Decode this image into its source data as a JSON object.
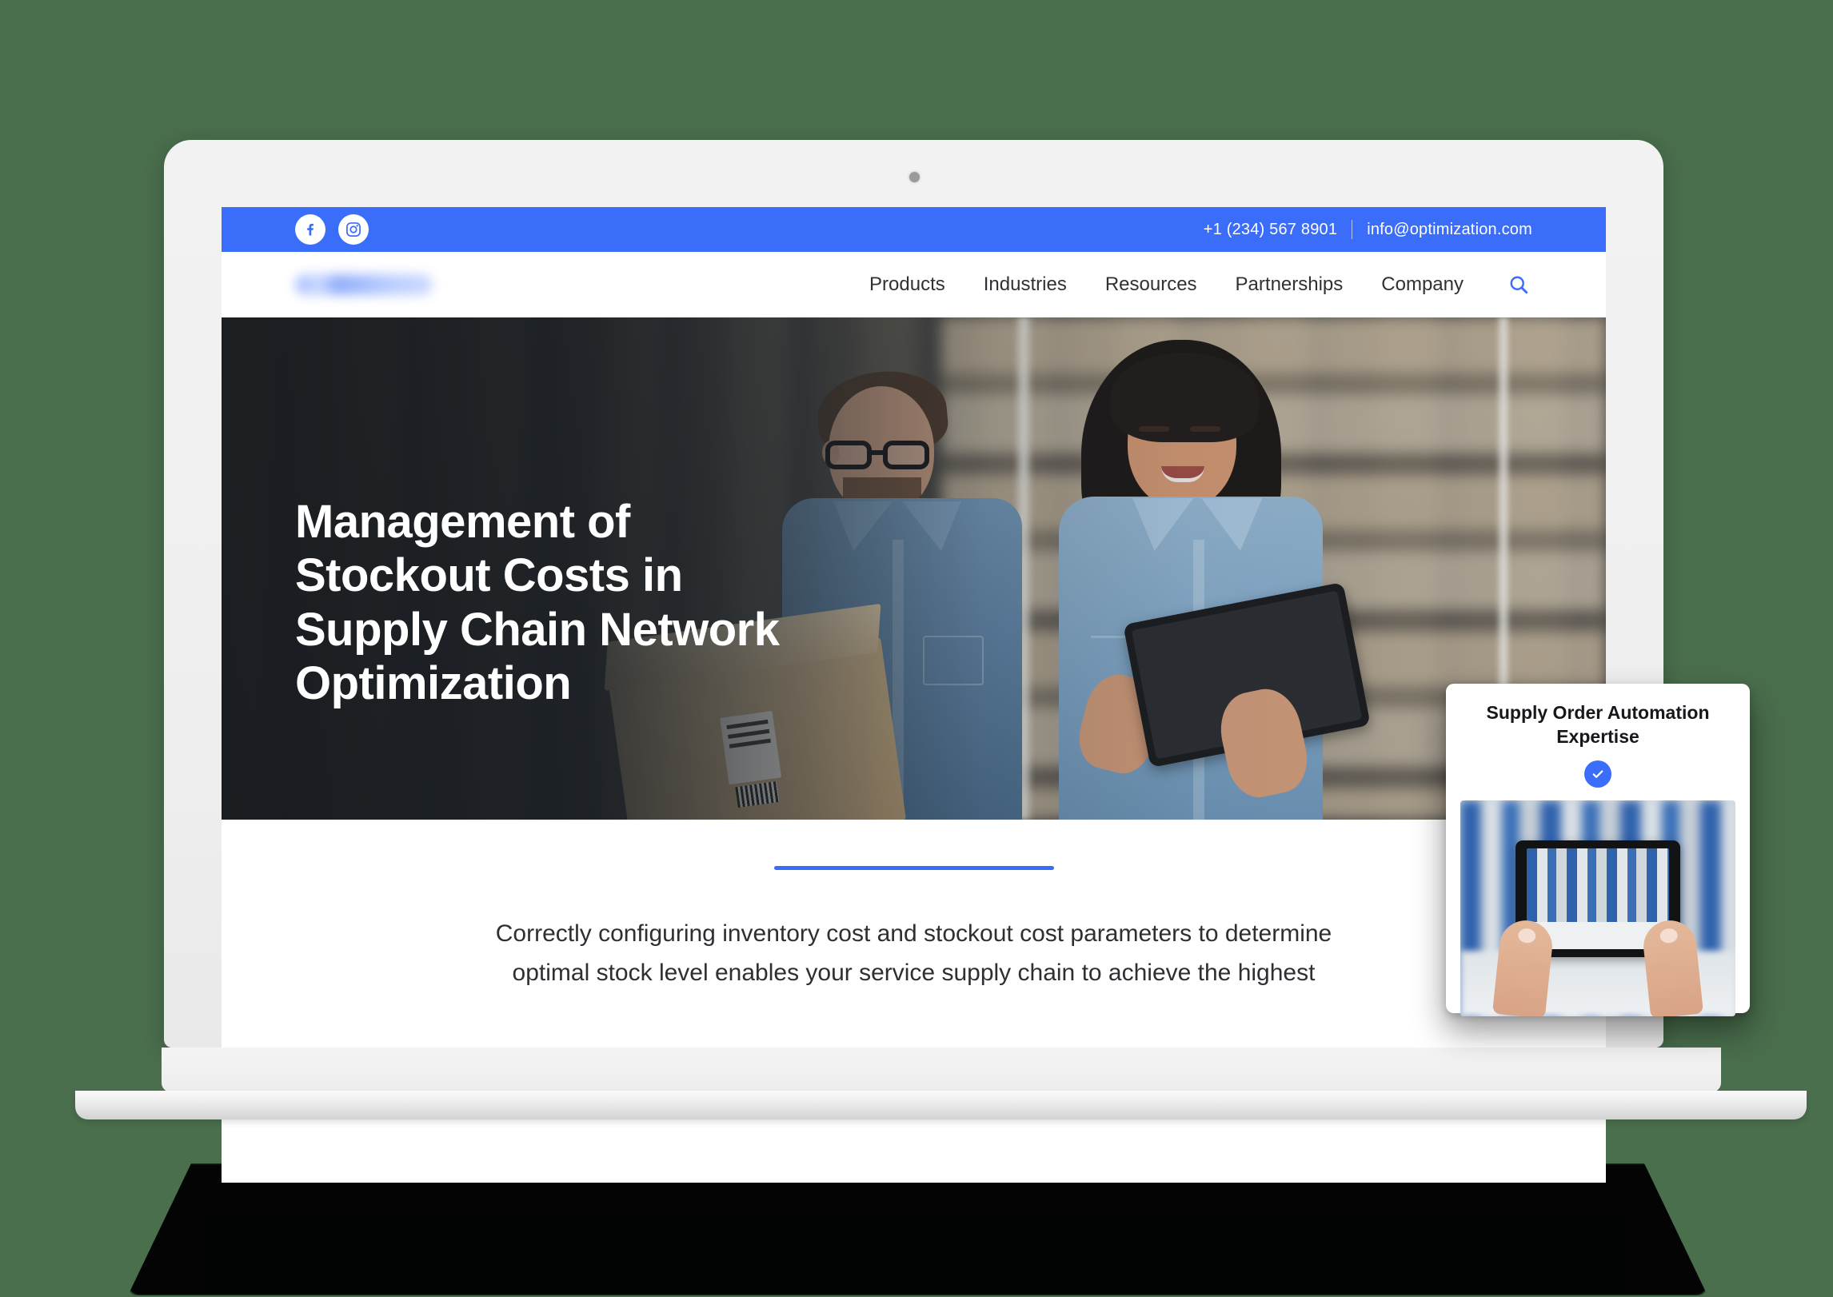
{
  "topbar": {
    "phone": "+1 (234) 567 8901",
    "email": "info@optimization.com",
    "social": [
      {
        "name": "facebook-icon",
        "label": "Facebook"
      },
      {
        "name": "instagram-icon",
        "label": "Instagram"
      }
    ]
  },
  "nav": {
    "logo_alt": "Company logo (blurred)",
    "items": [
      {
        "label": "Products"
      },
      {
        "label": "Industries"
      },
      {
        "label": "Resources"
      },
      {
        "label": "Partnerships"
      },
      {
        "label": "Company"
      }
    ],
    "search_icon": "search-icon"
  },
  "hero": {
    "title": "Management of Stockout Costs in Supply Chain Network Optimization",
    "image_alt": "Two warehouse workers in denim shirts reviewing a tablet beside a cardboard box"
  },
  "body": {
    "paragraph": "Correctly configuring inventory cost and stockout cost parameters to determine optimal stock level enables your service supply chain to achieve the highest"
  },
  "card": {
    "title": "Supply Order Automation Expertise",
    "badge_icon": "check-circle-icon",
    "image_alt": "Hands holding a tablet showing a warehouse of blue crates"
  },
  "colors": {
    "accent_blue": "#3b6dfb",
    "page_background": "#4a6f4d",
    "text_dark": "#2d2f33",
    "laptop_body": "#eeeeee"
  }
}
